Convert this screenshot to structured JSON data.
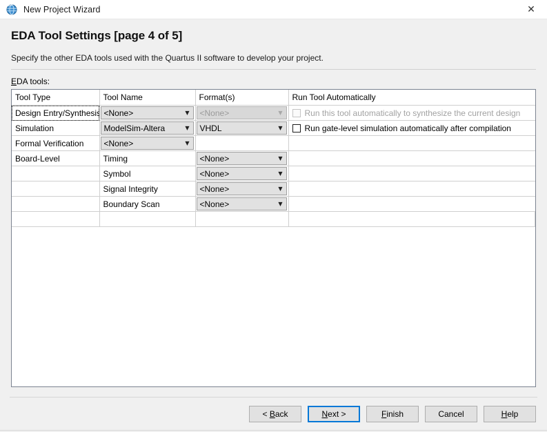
{
  "window": {
    "title": "New Project Wizard",
    "icon": "quartus-globe-icon",
    "close_label": "✕"
  },
  "page": {
    "title": "EDA Tool Settings [page 4 of 5]",
    "subtitle": "Specify the other EDA tools used with the Quartus II software to develop your project.",
    "field_label_prefix": "E",
    "field_label_rest": "DA tools:"
  },
  "table": {
    "headers": [
      "Tool Type",
      "Tool Name",
      "Format(s)",
      "Run Tool Automatically"
    ],
    "rows": [
      {
        "tool_type": "Design Entry/Synthesis",
        "tool_type_focused": true,
        "tool_name": {
          "kind": "combo",
          "value": "<None>",
          "disabled": false
        },
        "format": {
          "kind": "combo",
          "value": "<None>",
          "disabled": true
        },
        "run": {
          "kind": "checkbox",
          "label": "Run this tool automatically to synthesize the current design",
          "checked": false,
          "disabled": true
        }
      },
      {
        "tool_type": "Simulation",
        "tool_type_focused": false,
        "tool_name": {
          "kind": "combo",
          "value": "ModelSim-Altera",
          "disabled": false
        },
        "format": {
          "kind": "combo",
          "value": "VHDL",
          "disabled": false
        },
        "run": {
          "kind": "checkbox",
          "label": "Run gate-level simulation automatically after compilation",
          "checked": false,
          "disabled": false
        }
      },
      {
        "tool_type": "Formal Verification",
        "tool_type_focused": false,
        "tool_name": {
          "kind": "combo",
          "value": "<None>",
          "disabled": false
        },
        "format": {
          "kind": "empty"
        },
        "run": {
          "kind": "empty"
        }
      },
      {
        "tool_type": "Board-Level",
        "tool_type_focused": false,
        "tool_name": {
          "kind": "text",
          "value": "Timing"
        },
        "format": {
          "kind": "combo",
          "value": "<None>",
          "disabled": false
        },
        "run": {
          "kind": "empty"
        }
      },
      {
        "tool_type": "",
        "tool_type_focused": false,
        "tool_name": {
          "kind": "text",
          "value": "Symbol"
        },
        "format": {
          "kind": "combo",
          "value": "<None>",
          "disabled": false
        },
        "run": {
          "kind": "empty"
        }
      },
      {
        "tool_type": "",
        "tool_type_focused": false,
        "tool_name": {
          "kind": "text",
          "value": "Signal Integrity"
        },
        "format": {
          "kind": "combo",
          "value": "<None>",
          "disabled": false
        },
        "run": {
          "kind": "empty"
        }
      },
      {
        "tool_type": "",
        "tool_type_focused": false,
        "tool_name": {
          "kind": "text",
          "value": "Boundary Scan"
        },
        "format": {
          "kind": "combo",
          "value": "<None>",
          "disabled": false
        },
        "run": {
          "kind": "empty"
        }
      }
    ],
    "empty_rows": 1
  },
  "buttons": [
    {
      "name": "back-button",
      "label_pre": "< ",
      "accel": "B",
      "label_post": "ack",
      "default": false
    },
    {
      "name": "next-button",
      "label_pre": "",
      "accel": "N",
      "label_post": "ext >",
      "default": true
    },
    {
      "name": "finish-button",
      "label_pre": "",
      "accel": "F",
      "label_post": "inish",
      "default": false
    },
    {
      "name": "cancel-button",
      "label_pre": "Cancel",
      "accel": "",
      "label_post": "",
      "default": false
    },
    {
      "name": "help-button",
      "label_pre": "",
      "accel": "H",
      "label_post": "elp",
      "default": false
    }
  ],
  "colors": {
    "accent": "#0078d7",
    "window_bg": "#f0f0f0",
    "table_border": "#7a8290",
    "grid": "#cfcfcf",
    "combo_bg": "#e1e1e1"
  },
  "arrow_glyph": "▼"
}
